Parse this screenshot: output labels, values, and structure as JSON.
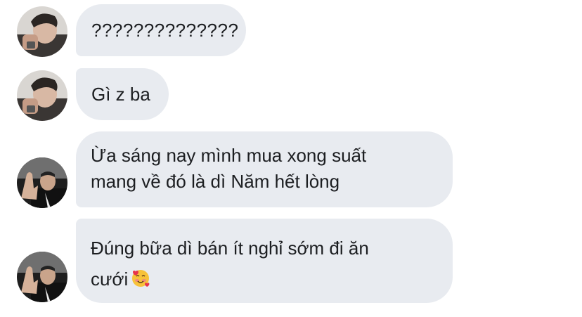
{
  "messages": [
    {
      "sender": "user-a",
      "text": "??????????????"
    },
    {
      "sender": "user-a",
      "text": "Gì z ba"
    },
    {
      "sender": "user-b",
      "text": "Ừa sáng nay mình mua xong suất\nmang về đó là dì Năm hết lòng"
    },
    {
      "sender": "user-b",
      "text": "Đúng bữa dì bán ít nghỉ sớm đi ăn\ncưới",
      "emoji": "smiling-face-with-hearts-emoji"
    }
  ],
  "colors": {
    "bubble_bg": "#e8ebf0",
    "text": "#1c1e21",
    "background": "#ffffff"
  }
}
